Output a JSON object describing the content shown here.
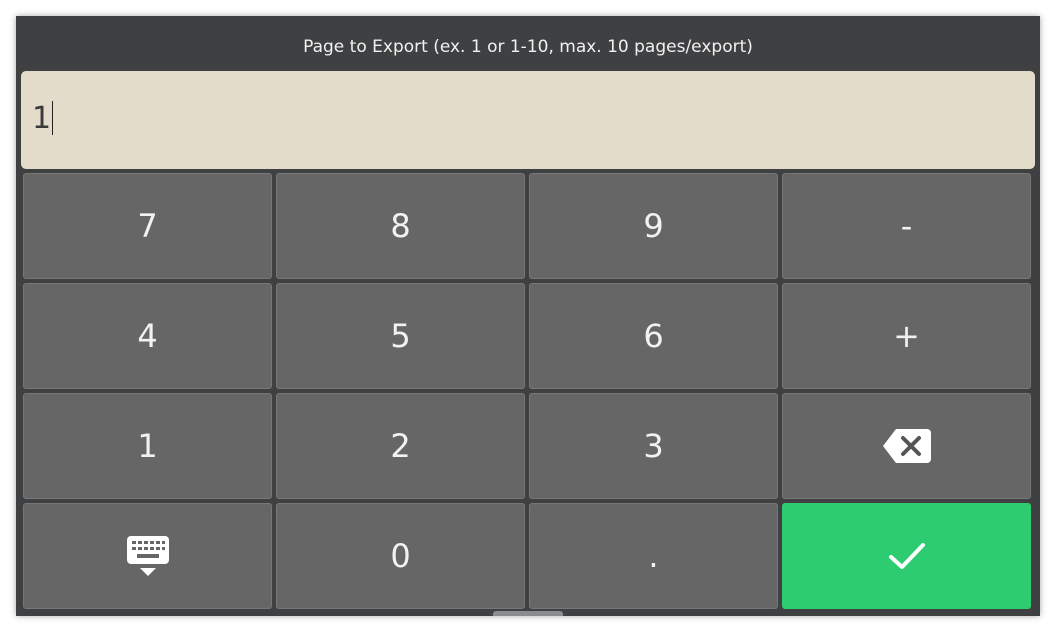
{
  "dialog": {
    "title": "Page to Export (ex. 1 or 1-10, max. 10 pages/export)"
  },
  "entry": {
    "value": "1"
  },
  "keypad": {
    "keys": [
      {
        "label": "7"
      },
      {
        "label": "8"
      },
      {
        "label": "9"
      },
      {
        "label": "-"
      },
      {
        "label": "4"
      },
      {
        "label": "5"
      },
      {
        "label": "6"
      },
      {
        "label": "+"
      },
      {
        "label": "1"
      },
      {
        "label": "2"
      },
      {
        "label": "3"
      },
      {
        "icon": "backspace-icon"
      },
      {
        "icon": "keyboard-hide-icon"
      },
      {
        "label": "0"
      },
      {
        "label": "."
      },
      {
        "icon": "checkmark-icon"
      }
    ]
  },
  "colors": {
    "dialog_bg": "#3f4042",
    "entry_bg": "#e4dccb",
    "key_bg": "#666666",
    "confirm_bg": "#2ecc71"
  }
}
